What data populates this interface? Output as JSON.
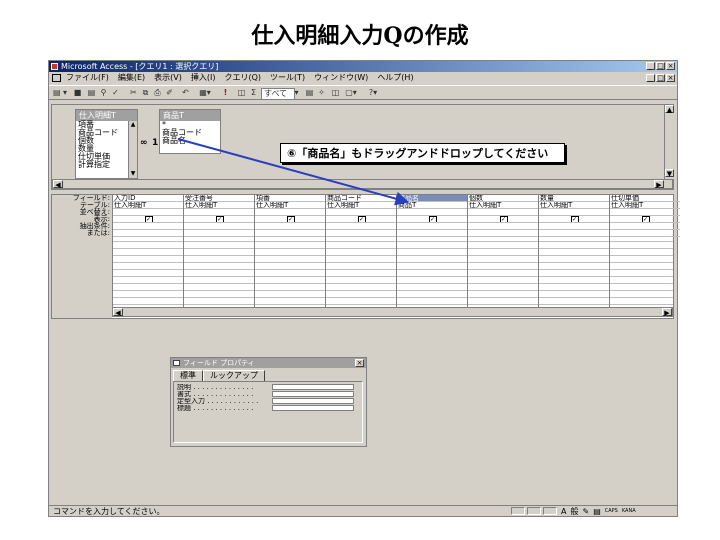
{
  "slide": {
    "title": "仕入明細入力Qの作成"
  },
  "window": {
    "title": "Microsoft Access - [クエリ1 : 選択クエリ]",
    "controls": [
      "_",
      "□",
      "×"
    ]
  },
  "menubar": {
    "items": [
      "ファイル(F)",
      "編集(E)",
      "表示(V)",
      "挿入(I)",
      "クエリ(Q)",
      "ツール(T)",
      "ウィンドウ(W)",
      "ヘルプ(H)"
    ]
  },
  "toolbar": {
    "view_label": "▤ ▾",
    "run_label": "!",
    "sigma_label": "Σ",
    "top_values": "すべて",
    "help_label": "?▾"
  },
  "tables": [
    {
      "name": "仕入明細T",
      "fields": [
        "項番",
        "商品コード",
        "個数",
        "数量",
        "仕切単価",
        "計算指定"
      ]
    },
    {
      "name": "商品T",
      "fields": [
        "*",
        "商品コード",
        "商品名"
      ]
    }
  ],
  "relation": {
    "one": "1",
    "many": "∞"
  },
  "callout": "⑥「商品名」もドラッグアンドドロップしてください",
  "grid": {
    "row_labels": [
      "フィールド:",
      "テーブル:",
      "並べ替え:",
      "表示:",
      "抽出条件:",
      "または:"
    ],
    "columns": [
      {
        "field": "入力ID",
        "table": "仕入明細T",
        "show": true
      },
      {
        "field": "受注番号",
        "table": "仕入明細T",
        "show": true
      },
      {
        "field": "項番",
        "table": "仕入明細T",
        "show": true
      },
      {
        "field": "商品コード",
        "table": "仕入明細T",
        "show": true
      },
      {
        "field": "商品名",
        "table": "商品T",
        "show": true
      },
      {
        "field": "個数",
        "table": "仕入明細T",
        "show": true
      },
      {
        "field": "数量",
        "table": "仕入明細T",
        "show": true
      },
      {
        "field": "仕切単価",
        "table": "仕入明細T",
        "show": true
      }
    ]
  },
  "properties": {
    "title": "フィールド プロパティ",
    "tabs": [
      "標準",
      "ルックアップ"
    ],
    "rows": [
      "説明 . . . . . . . . . . . . . .",
      "書式 . . . . . . . . . . . . . .",
      "定型入力 . . . . . . . . . . . .",
      "標題 . . . . . . . . . . . . . ."
    ]
  },
  "statusbar": {
    "text": "コマンドを入力してください。",
    "ime": [
      "A",
      "般",
      "CAPS",
      "KANA"
    ]
  },
  "colors": {
    "titlebar": "#0a246a",
    "arrow": "#2a3fbf",
    "face": "#d4d0c8"
  }
}
